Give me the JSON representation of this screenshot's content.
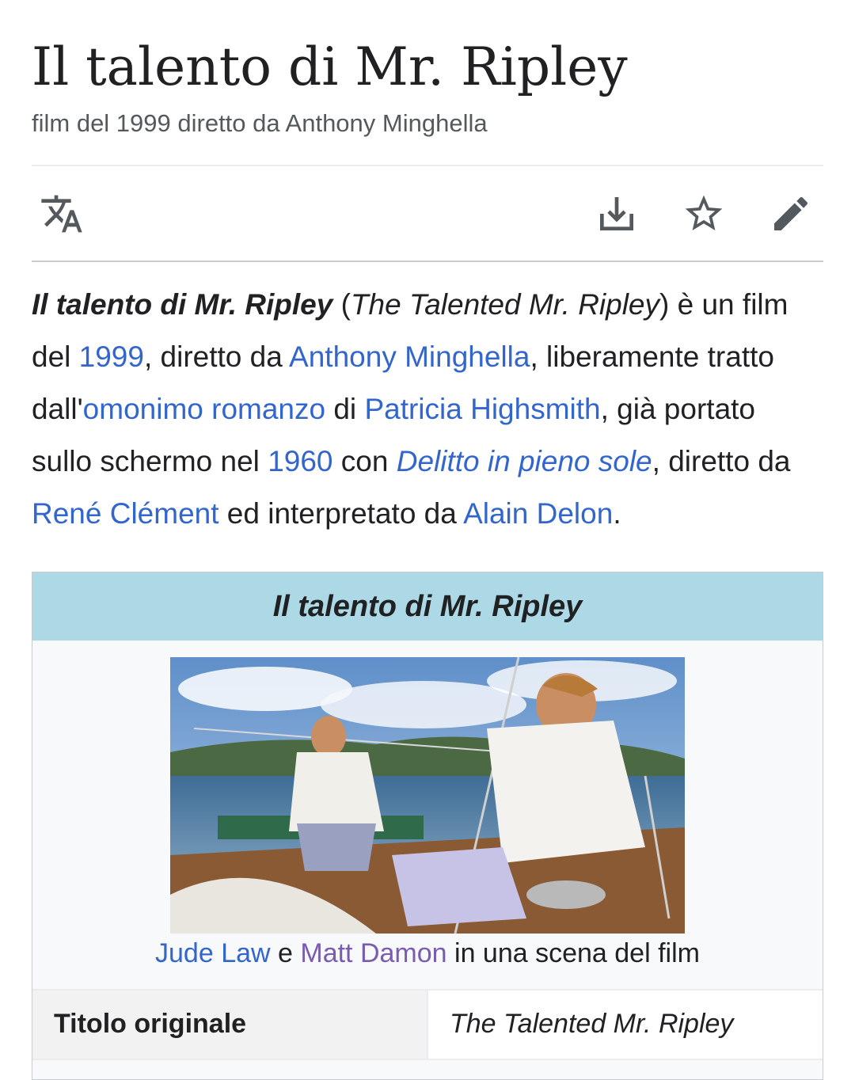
{
  "page": {
    "title": "Il talento di Mr. Ripley",
    "subtitle": "film del 1999 diretto da Anthony Minghella"
  },
  "toolbar": {
    "icons": [
      "language-icon",
      "download-icon",
      "star-icon",
      "edit-icon"
    ]
  },
  "lead": {
    "title_bold": "Il talento di Mr. Ripley",
    "open_paren": " (",
    "original_title": "The Talented Mr. Ripley",
    "t1": ") è un film del ",
    "link_year": "1999",
    "t2": ", diretto da ",
    "link_director": "Anthony Minghella",
    "t3": ", liberamente tratto dall'",
    "link_novel": "omonimo romanzo",
    "t4": " di ",
    "link_author": "Patricia Highsmith",
    "t5": ", già portato sullo schermo nel ",
    "link_year2": "1960",
    "t6": " con ",
    "link_film": "Delitto in pieno sole",
    "t7": ", diretto da ",
    "link_director2": "René Clément",
    "t8": " ed interpretato da ",
    "link_actor": "Alain Delon",
    "t9": "."
  },
  "infobox": {
    "header": "Il talento di Mr. Ripley",
    "caption": {
      "link1": "Jude Law",
      "mid": " e ",
      "link2": "Matt Damon",
      "tail": " in una scena del film"
    },
    "rows": [
      {
        "label": "Titolo originale",
        "value": "The Talented Mr. Ripley"
      }
    ]
  },
  "colors": {
    "link": "#3366cc",
    "visited_link": "#795cb2",
    "infobox_header": "#add8e6",
    "text": "#202122",
    "icon": "#54595d"
  }
}
